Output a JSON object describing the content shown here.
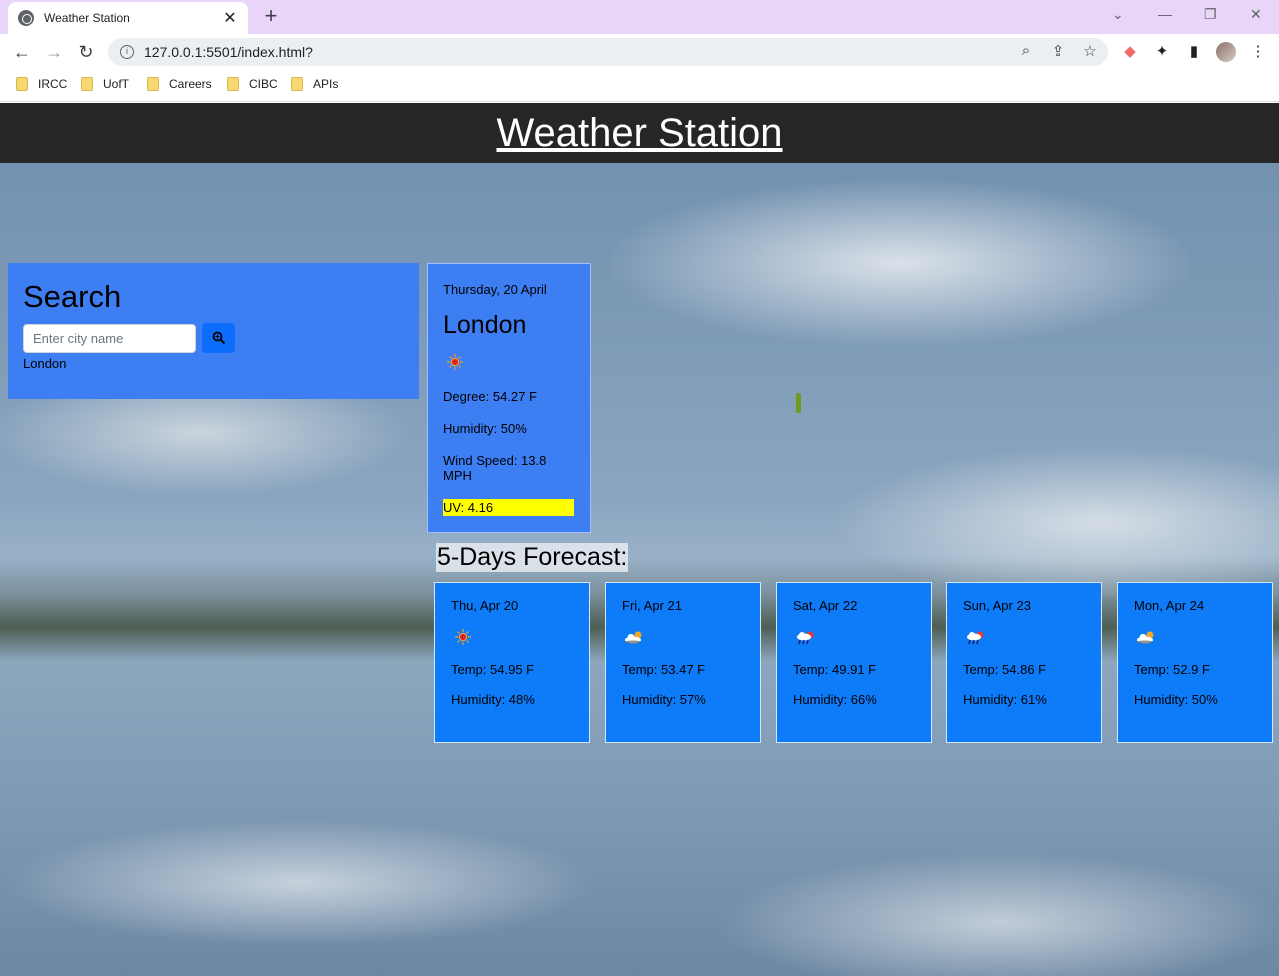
{
  "browser": {
    "tab_title": "Weather Station",
    "url": "127.0.0.1:5501/index.html?",
    "bookmarks": [
      "IRCC",
      "UofT",
      "Careers",
      "CIBC",
      "APIs"
    ]
  },
  "header": {
    "title": "Weather Station"
  },
  "search": {
    "title": "Search",
    "placeholder": "Enter city name",
    "history": [
      "London"
    ]
  },
  "current": {
    "date": "Thursday, 20 April",
    "city": "London",
    "icon": "sun-icon",
    "degree": "Degree: 54.27 F",
    "humidity": "Humidity: 50%",
    "wind": "Wind Speed: 13.8 MPH",
    "uv": "UV: 4.16",
    "uv_color": "#ffff00"
  },
  "forecast": {
    "title": "5-Days Forecast:",
    "days": [
      {
        "date": "Thu, Apr 20",
        "icon": "sun-icon",
        "temp": "Temp: 54.95 F",
        "humidity": "Humidity: 48%"
      },
      {
        "date": "Fri, Apr 21",
        "icon": "cloud-sun-icon",
        "temp": "Temp: 53.47 F",
        "humidity": "Humidity: 57%"
      },
      {
        "date": "Sat, Apr 22",
        "icon": "cloud-rain-sun-icon",
        "temp": "Temp: 49.91 F",
        "humidity": "Humidity: 66%"
      },
      {
        "date": "Sun, Apr 23",
        "icon": "cloud-rain-sun-icon",
        "temp": "Temp: 54.86 F",
        "humidity": "Humidity: 61%"
      },
      {
        "date": "Mon, Apr 24",
        "icon": "cloud-sun-icon",
        "temp": "Temp: 52.9 F",
        "humidity": "Humidity: 50%"
      }
    ]
  },
  "colors": {
    "card": "#3d7ef2",
    "forecast_card": "#0e7bf9",
    "header": "#262626",
    "button": "#0d6efd"
  }
}
